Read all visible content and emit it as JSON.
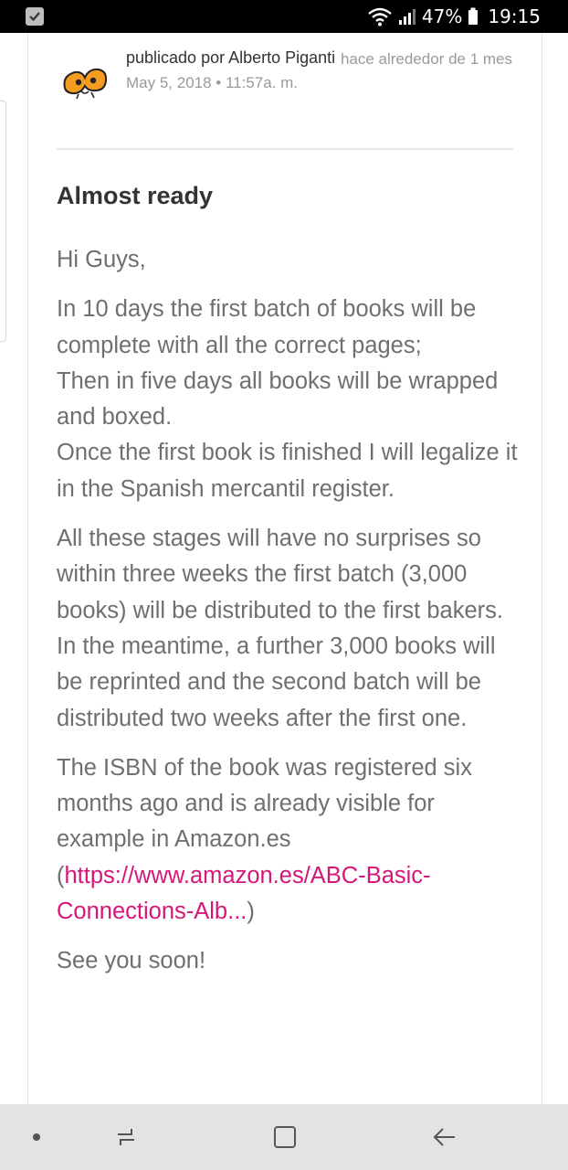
{
  "status_bar": {
    "battery": "47%",
    "time": "19:15"
  },
  "post": {
    "published_by": "publicado por Alberto Piganti",
    "date": "May 5, 2018 • 11:57a. m.",
    "relative_time": "hace alrededor de 1 mes",
    "title": "Almost ready",
    "greeting": "Hi Guys,",
    "para1_line1": "In 10 days the first batch of books will be complete with all the correct pages;",
    "para1_line2": "Then in five days all books will be wrapped and boxed.",
    "para1_line3": "Once the first book is finished I will legalize it in the Spanish mercantil register.",
    "para2_line1": "All these stages will have no surprises so within three weeks the first batch (3,000 books) will be distributed to the first bakers.",
    "para2_line2": "In the meantime, a further 3,000 books will be reprinted and the second batch will be distributed two weeks after the first one.",
    "para3_text": "The ISBN of the book was registered six months ago and is already visible for example in Amazon.es",
    "para3_open": "(",
    "link_text": "https://www.amazon.es/ABC-Basic-Connections-Alb...",
    "para3_close": ")",
    "signoff": "See you soon!"
  },
  "colors": {
    "link": "#d6177a",
    "body_text": "#6f6f6f",
    "meta_text": "#9a9a9a"
  },
  "icons": {
    "avatar": "orange-bug-logo",
    "status_app": "checkbox-icon",
    "wifi": "wifi-icon",
    "signal": "signal-icon",
    "battery": "battery-icon",
    "nav_recents": "recents-icon",
    "nav_home": "home-icon",
    "nav_back": "back-arrow-icon"
  }
}
